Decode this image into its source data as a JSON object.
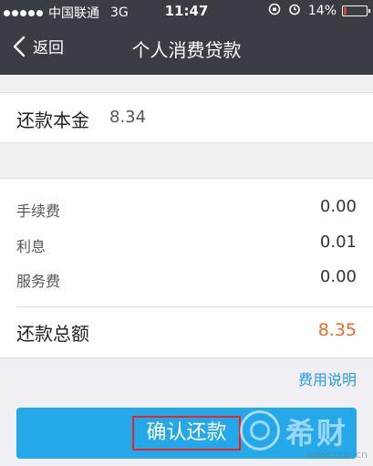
{
  "status_bar": {
    "carrier": "中国联通",
    "network": "3G",
    "time": "11:47",
    "battery": "14%",
    "battery_level": 0.14,
    "icons": [
      "signal-dots-icon",
      "rotation-lock-icon",
      "alarm-icon",
      "battery-icon"
    ]
  },
  "nav": {
    "back_label": "返回",
    "title": "个人消费贷款",
    "back_icon": "chevron-left-icon"
  },
  "principal": {
    "label": "还款本金",
    "value": "8.34"
  },
  "fees": [
    {
      "label": "手续费",
      "value": "0.00"
    },
    {
      "label": "利息",
      "value": "0.01"
    },
    {
      "label": "服务费",
      "value": "0.00"
    }
  ],
  "total": {
    "label": "还款总额",
    "value": "8.35"
  },
  "fee_desc_link": "费用说明",
  "confirm_button": "确认还款",
  "watermark": {
    "text": "希财",
    "url": "www.csai.cn"
  },
  "colors": {
    "nav_background": "#3a3d44",
    "accent": "#25a8e9",
    "total_value": "#f06a22",
    "link": "#2a9de3",
    "highlight_box": "#ee2222"
  }
}
